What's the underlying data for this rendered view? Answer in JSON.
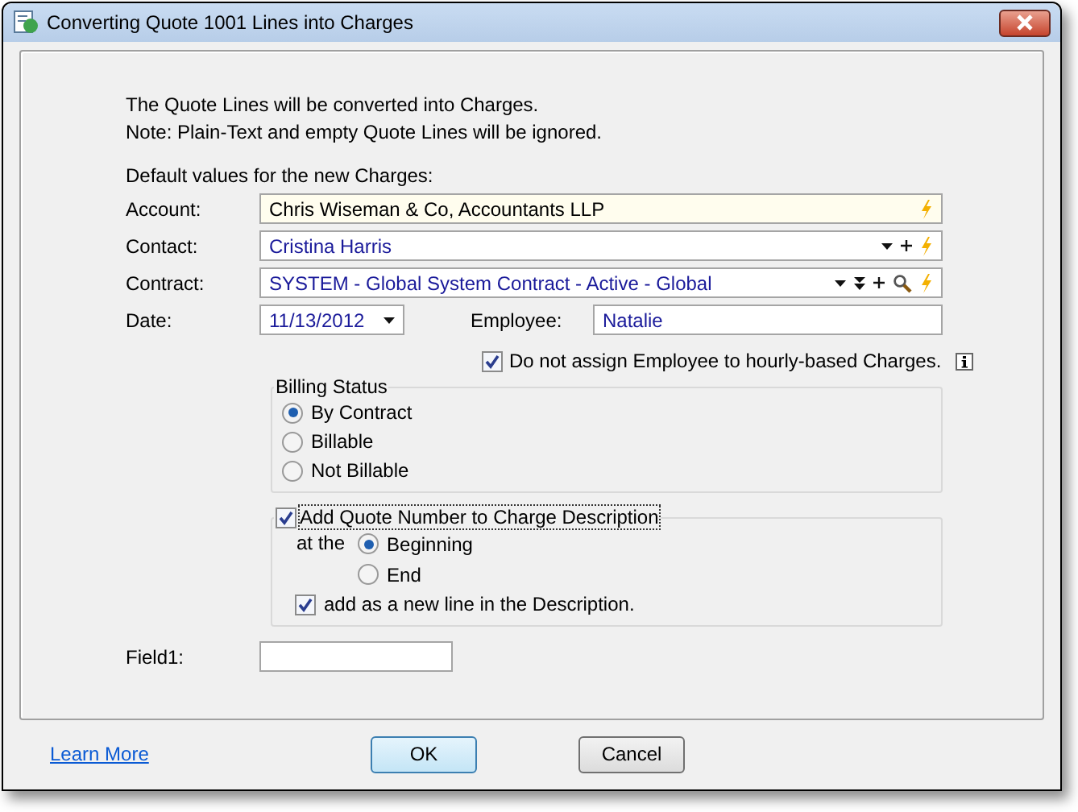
{
  "window": {
    "title": "Converting Quote 1001 Lines into Charges"
  },
  "intro": [
    "The Quote Lines will be converted into Charges.",
    "Note: Plain-Text and empty Quote Lines will be ignored."
  ],
  "section_label": "Default values for the new Charges:",
  "account": {
    "label": "Account:",
    "value": "Chris Wiseman & Co, Accountants LLP"
  },
  "contact": {
    "label": "Contact:",
    "value": "Cristina Harris"
  },
  "contract": {
    "label": "Contract:",
    "value": "SYSTEM - Global System Contract - Active -  Global"
  },
  "date": {
    "label": "Date:",
    "value": "11/13/2012"
  },
  "employee": {
    "label": "Employee:",
    "value": "Natalie"
  },
  "no_assign": {
    "label": "Do not assign Employee to hourly-based Charges.",
    "checked": true
  },
  "billing_status": {
    "title": "Billing Status",
    "options": [
      {
        "label": "By Contract",
        "selected": true
      },
      {
        "label": "Billable",
        "selected": false
      },
      {
        "label": "Not Billable",
        "selected": false
      }
    ]
  },
  "quote_number": {
    "label": "Add Quote Number to Charge Description",
    "checked": true,
    "at_label": "at the",
    "positions": [
      {
        "label": "Beginning",
        "selected": true
      },
      {
        "label": "End",
        "selected": false
      }
    ],
    "new_line": {
      "label": "add as a new line in the Description.",
      "checked": true
    }
  },
  "field1": {
    "label": "Field1:"
  },
  "footer": {
    "link": "Learn More",
    "buttons": [
      {
        "label": "OK",
        "kind": "default"
      },
      {
        "label": "Cancel",
        "kind": "normal"
      }
    ]
  }
}
